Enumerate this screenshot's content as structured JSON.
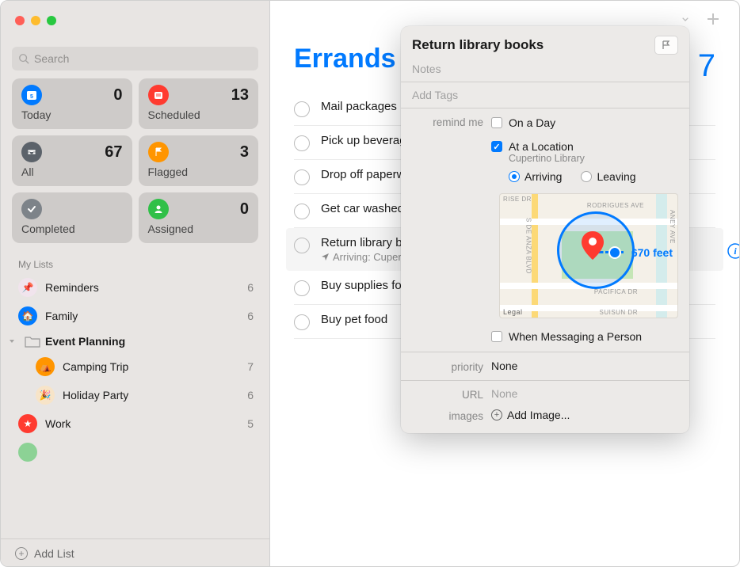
{
  "search": {
    "placeholder": "Search"
  },
  "smart": [
    {
      "id": "today",
      "label": "Today",
      "count": "0",
      "bg": "#017aff",
      "icon": "calendar"
    },
    {
      "id": "scheduled",
      "label": "Scheduled",
      "count": "13",
      "bg": "#ff3b30",
      "icon": "calendar-stack"
    },
    {
      "id": "all",
      "label": "All",
      "count": "67",
      "bg": "#5b626a",
      "icon": "tray"
    },
    {
      "id": "flagged",
      "label": "Flagged",
      "count": "3",
      "bg": "#ff9500",
      "icon": "flag"
    },
    {
      "id": "completed",
      "label": "Completed",
      "count": "",
      "bg": "#7d8389",
      "icon": "check"
    },
    {
      "id": "assigned",
      "label": "Assigned",
      "count": "0",
      "bg": "#30c048",
      "icon": "person"
    }
  ],
  "lists_header": "My Lists",
  "lists": [
    {
      "name": "Reminders",
      "count": "6",
      "color": "#f1e4ed",
      "emoji": "📌"
    },
    {
      "name": "Family",
      "count": "6",
      "color": "#017aff",
      "emoji": "🏠"
    }
  ],
  "folder": {
    "name": "Event Planning"
  },
  "folder_children": [
    {
      "name": "Camping Trip",
      "count": "7",
      "color": "#ff9500",
      "emoji": "⛺"
    },
    {
      "name": "Holiday Party",
      "count": "6",
      "color": "#f7e4c8",
      "emoji": "🎉"
    }
  ],
  "more_lists": [
    {
      "name": "Work",
      "count": "5",
      "color": "#ff3b30",
      "emoji": "★"
    }
  ],
  "add_list_label": "Add List",
  "main": {
    "title": "Errands",
    "big_count": "7",
    "reminders": [
      {
        "title": "Mail packages"
      },
      {
        "title": "Pick up beverages"
      },
      {
        "title": "Drop off paperwork"
      },
      {
        "title": "Get car washed"
      },
      {
        "title": "Return library books",
        "sub": "Arriving: Cupertino Library",
        "selected": true
      },
      {
        "title": "Buy supplies for party"
      },
      {
        "title": "Buy pet food"
      }
    ]
  },
  "popover": {
    "title": "Return library books",
    "notes_placeholder": "Notes",
    "tags_placeholder": "Add Tags",
    "remind_me_label": "remind me",
    "on_day_label": "On a Day",
    "at_location_label": "At a Location",
    "location_sub": "Cupertino Library",
    "arriving_label": "Arriving",
    "leaving_label": "Leaving",
    "distance": "670 feet",
    "messaging_label": "When Messaging a Person",
    "priority_label": "priority",
    "priority_value": "None",
    "url_label": "URL",
    "url_value": "None",
    "images_label": "images",
    "add_image_label": "Add Image...",
    "streets": {
      "rise": "RISE DR",
      "anza": "S DE ANZA BLVD",
      "rodrigues": "RODRIGUES AVE",
      "aney": "ANEY AVE",
      "pacifica": "PACIFICA DR",
      "suisun": "SUISUN DR",
      "legal": "Legal"
    }
  }
}
